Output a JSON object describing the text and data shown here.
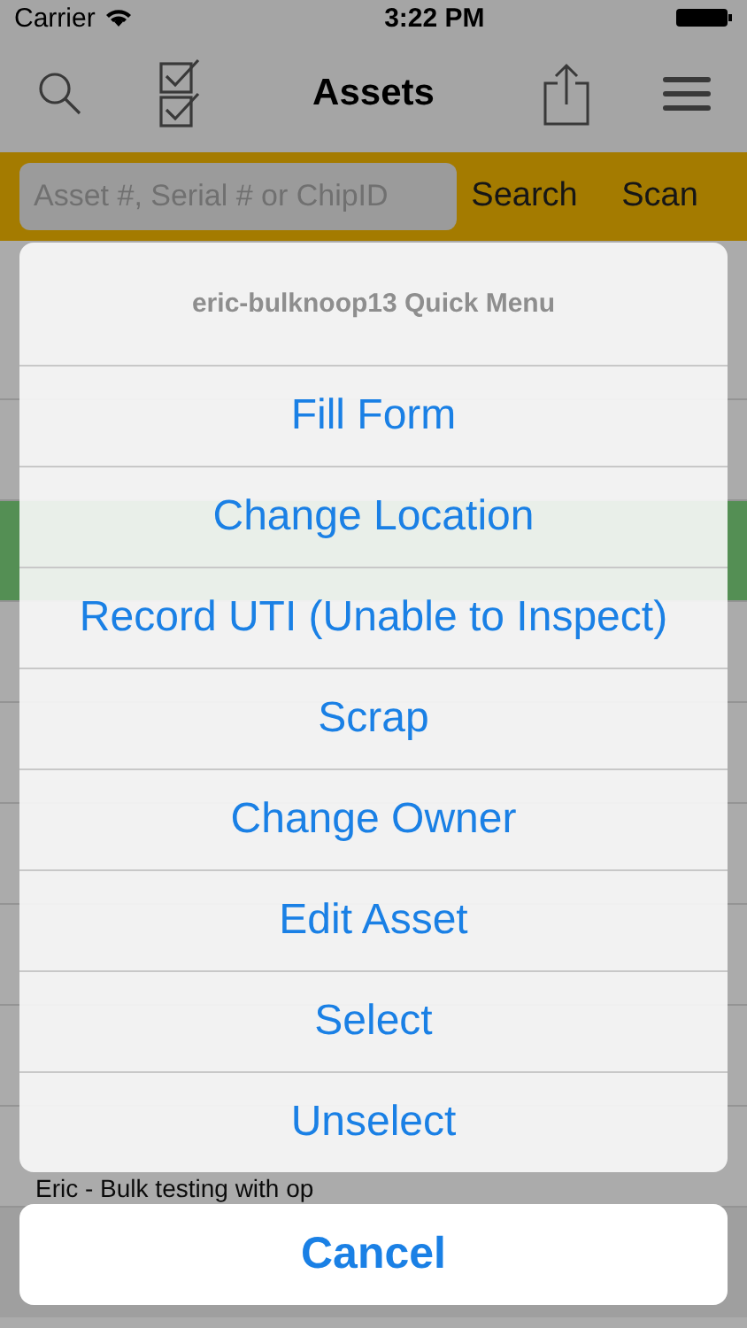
{
  "status_bar": {
    "carrier": "Carrier",
    "time": "3:22 PM"
  },
  "nav_bar": {
    "title": "Assets"
  },
  "search": {
    "placeholder": "Asset #, Serial # or ChipID",
    "buttons": [
      "Search",
      "Scan"
    ]
  },
  "list": {
    "rows": [
      {
        "selected": false
      },
      {
        "selected": false
      },
      {
        "selected": true
      },
      {
        "selected": false
      },
      {
        "selected": false
      },
      {
        "selected": false
      },
      {
        "selected": false
      },
      {
        "selected": false
      },
      {
        "selected": false,
        "subtitle": "Eric - Bulk testing with op"
      }
    ]
  },
  "action_sheet": {
    "title": "eric-bulknoop13 Quick Menu",
    "items": [
      "Fill Form",
      "Change Location",
      "Record UTI (Unable to Inspect)",
      "Scrap",
      "Change Owner",
      "Edit Asset",
      "Select",
      "Unselect"
    ],
    "cancel": "Cancel"
  }
}
